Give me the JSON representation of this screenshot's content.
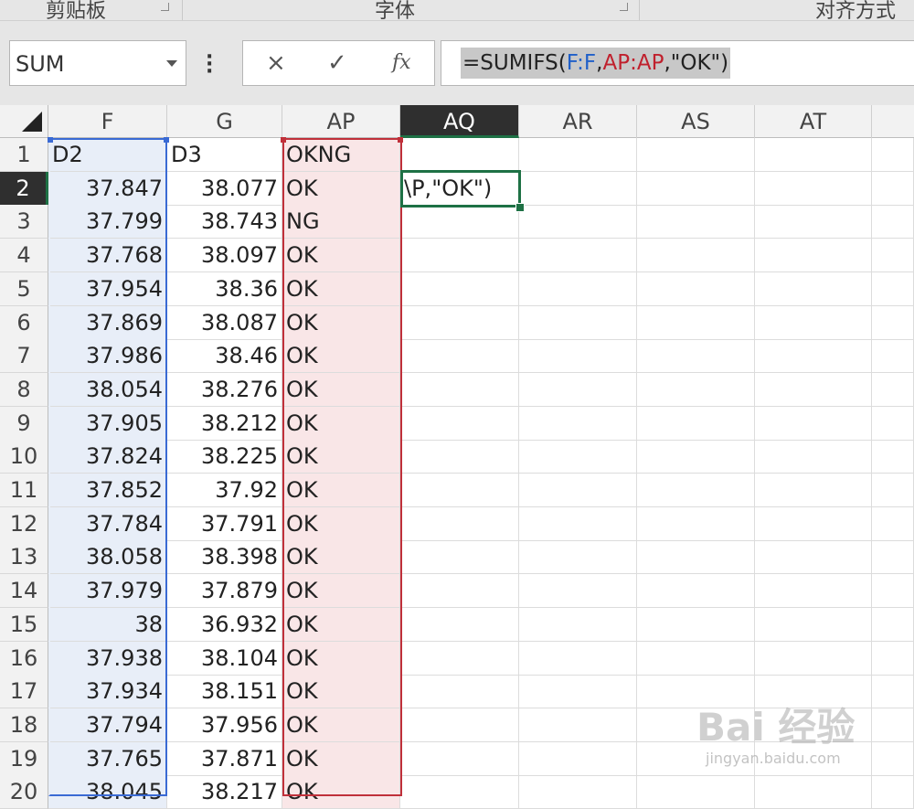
{
  "ribbon": {
    "groups": [
      "剪贴板",
      "字体",
      "对齐方式"
    ]
  },
  "formula_bar": {
    "name_box": "SUM",
    "cancel_icon": "×",
    "enter_icon": "✓",
    "fx_label": "fx",
    "formula": {
      "p1": "=SUMIFS(",
      "ref1": "F:F",
      "p2": ",",
      "ref2": "AP:AP",
      "p3": ",\"OK\")"
    }
  },
  "columns": [
    "F",
    "G",
    "AP",
    "AQ",
    "AR",
    "AS",
    "AT"
  ],
  "active_column": "AQ",
  "active_row": "2",
  "rows": [
    {
      "n": "1",
      "F": "D2",
      "G": "D3",
      "AP": "OKNG"
    },
    {
      "n": "2",
      "F": "37.847",
      "G": "38.077",
      "AP": "OK"
    },
    {
      "n": "3",
      "F": "37.799",
      "G": "38.743",
      "AP": "NG"
    },
    {
      "n": "4",
      "F": "37.768",
      "G": "38.097",
      "AP": "OK"
    },
    {
      "n": "5",
      "F": "37.954",
      "G": "38.36",
      "AP": "OK"
    },
    {
      "n": "6",
      "F": "37.869",
      "G": "38.087",
      "AP": "OK"
    },
    {
      "n": "7",
      "F": "37.986",
      "G": "38.46",
      "AP": "OK"
    },
    {
      "n": "8",
      "F": "38.054",
      "G": "38.276",
      "AP": "OK"
    },
    {
      "n": "9",
      "F": "37.905",
      "G": "38.212",
      "AP": "OK"
    },
    {
      "n": "10",
      "F": "37.824",
      "G": "38.225",
      "AP": "OK"
    },
    {
      "n": "11",
      "F": "37.852",
      "G": "37.92",
      "AP": "OK"
    },
    {
      "n": "12",
      "F": "37.784",
      "G": "37.791",
      "AP": "OK"
    },
    {
      "n": "13",
      "F": "38.058",
      "G": "38.398",
      "AP": "OK"
    },
    {
      "n": "14",
      "F": "37.979",
      "G": "37.879",
      "AP": "OK"
    },
    {
      "n": "15",
      "F": "38",
      "G": "36.932",
      "AP": "OK"
    },
    {
      "n": "16",
      "F": "37.938",
      "G": "38.104",
      "AP": "OK"
    },
    {
      "n": "17",
      "F": "37.934",
      "G": "38.151",
      "AP": "OK"
    },
    {
      "n": "18",
      "F": "37.794",
      "G": "37.956",
      "AP": "OK"
    },
    {
      "n": "19",
      "F": "37.765",
      "G": "37.871",
      "AP": "OK"
    },
    {
      "n": "20",
      "F": "38.045",
      "G": "38.217",
      "AP": "OK"
    }
  ],
  "active_cell_text": "\\P,\"OK\")",
  "watermark": {
    "brand": "Bai 经验",
    "url": "jingyan.baidu.com"
  },
  "colors": {
    "blue_range": "#3a6ad4",
    "red_range": "#c0303a",
    "active_green": "#1e7145"
  }
}
